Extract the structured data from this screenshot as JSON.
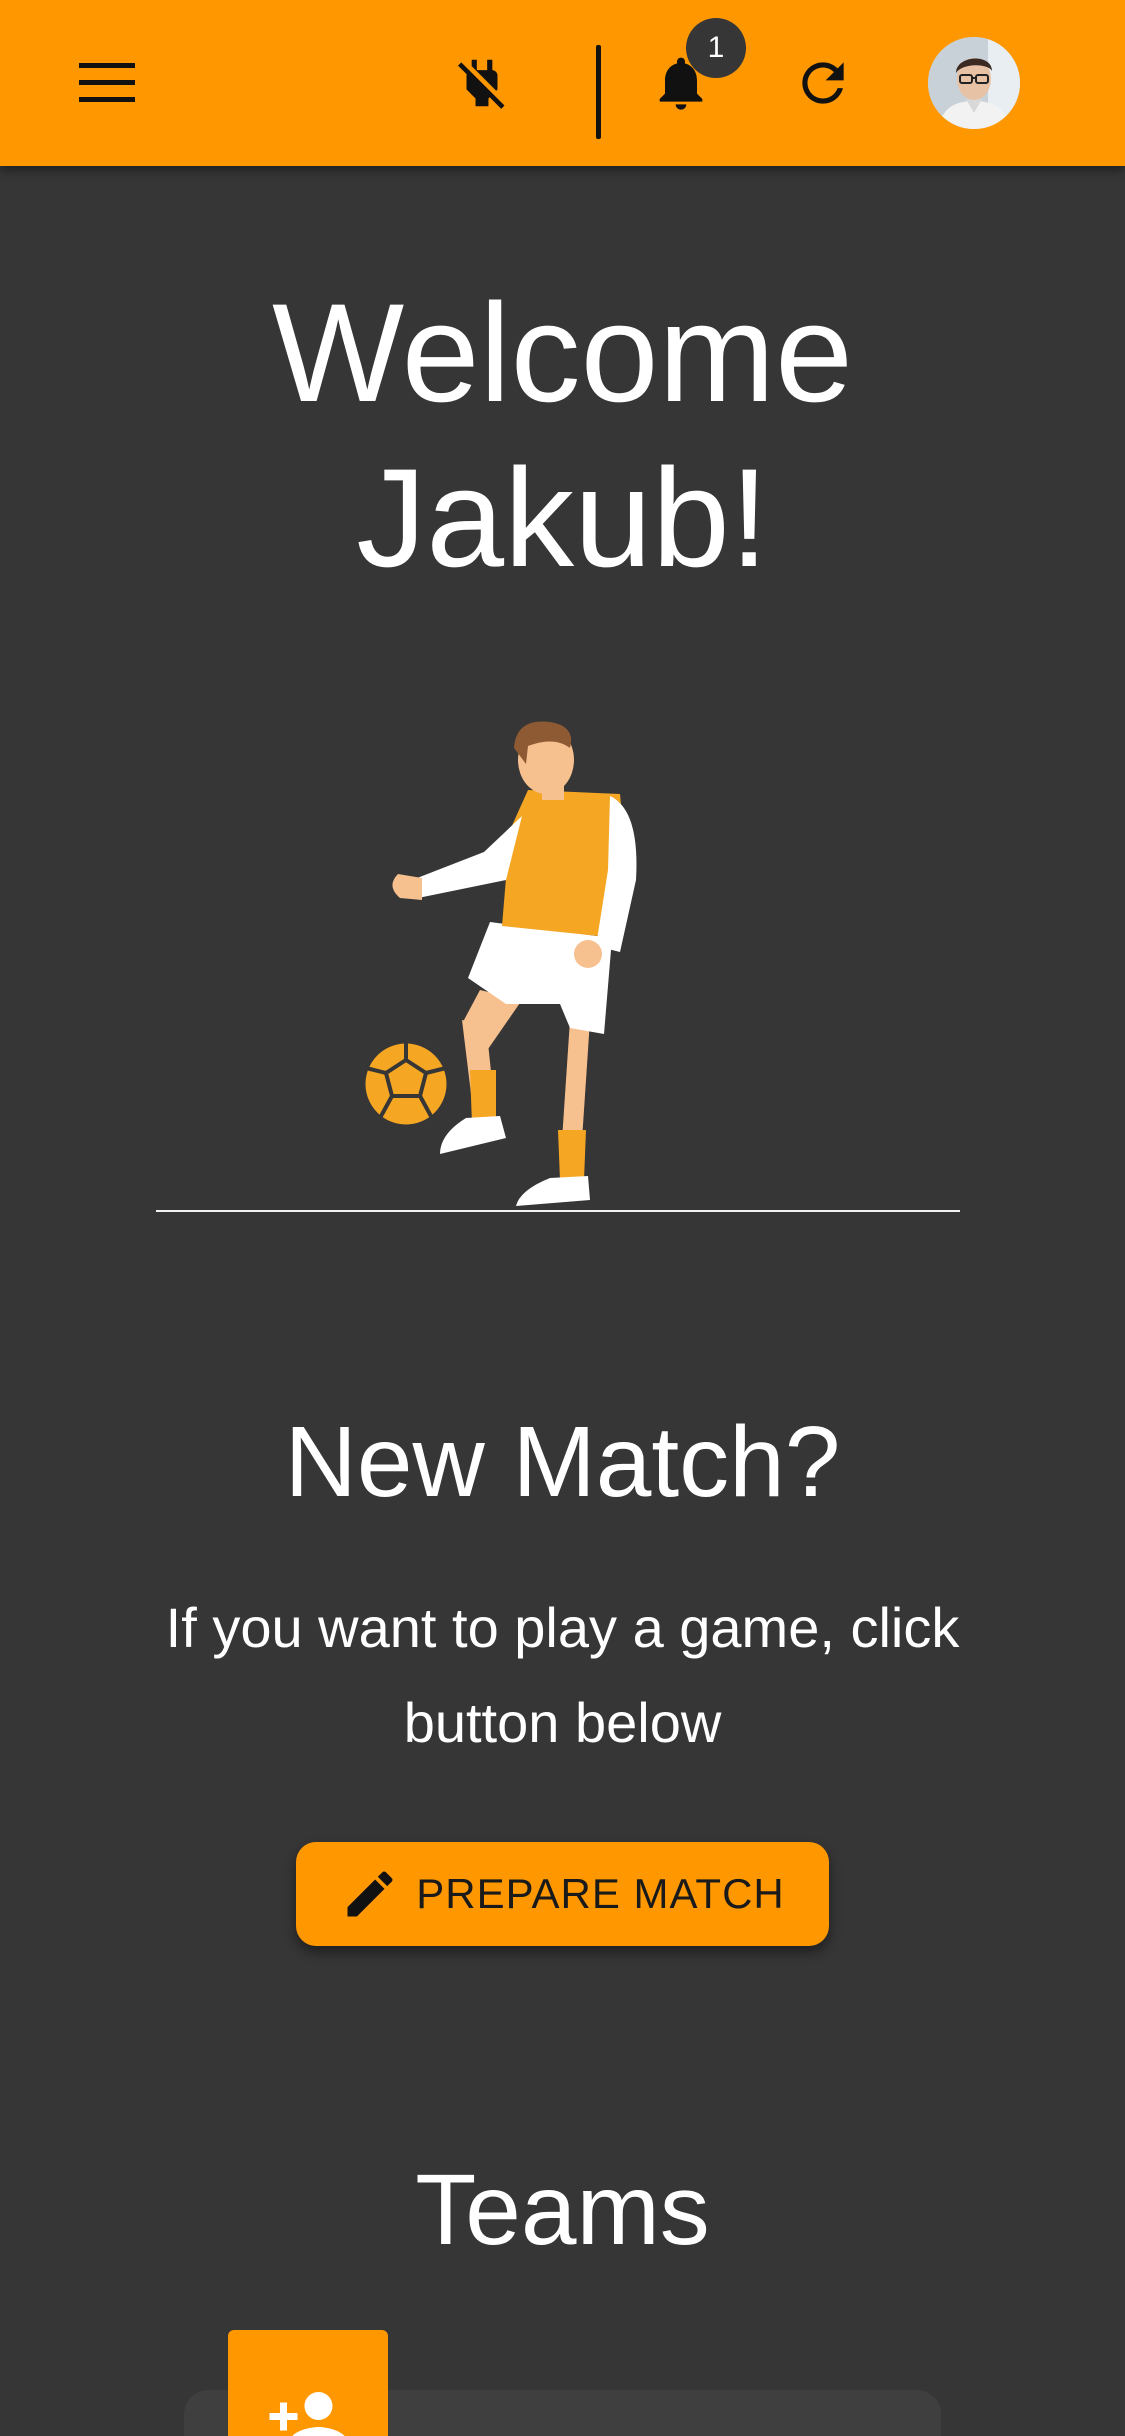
{
  "topbar": {
    "background": "#ff9800",
    "icons": {
      "menu": "menu-icon",
      "plug": "power-off-icon",
      "bell": "bell-icon",
      "refresh": "refresh-icon"
    },
    "notification_count": "1"
  },
  "main": {
    "welcome_line1": "Welcome",
    "welcome_line2": "Jakub!",
    "new_match": {
      "title": "New Match?",
      "text": "If you want to play a game, click button below",
      "button_label": "PREPARE MATCH",
      "button_icon": "pencil-icon"
    },
    "teams": {
      "title": "Teams",
      "add_icon": "add-person-icon"
    }
  },
  "colors": {
    "accent": "#ff9800",
    "background": "#363636"
  }
}
